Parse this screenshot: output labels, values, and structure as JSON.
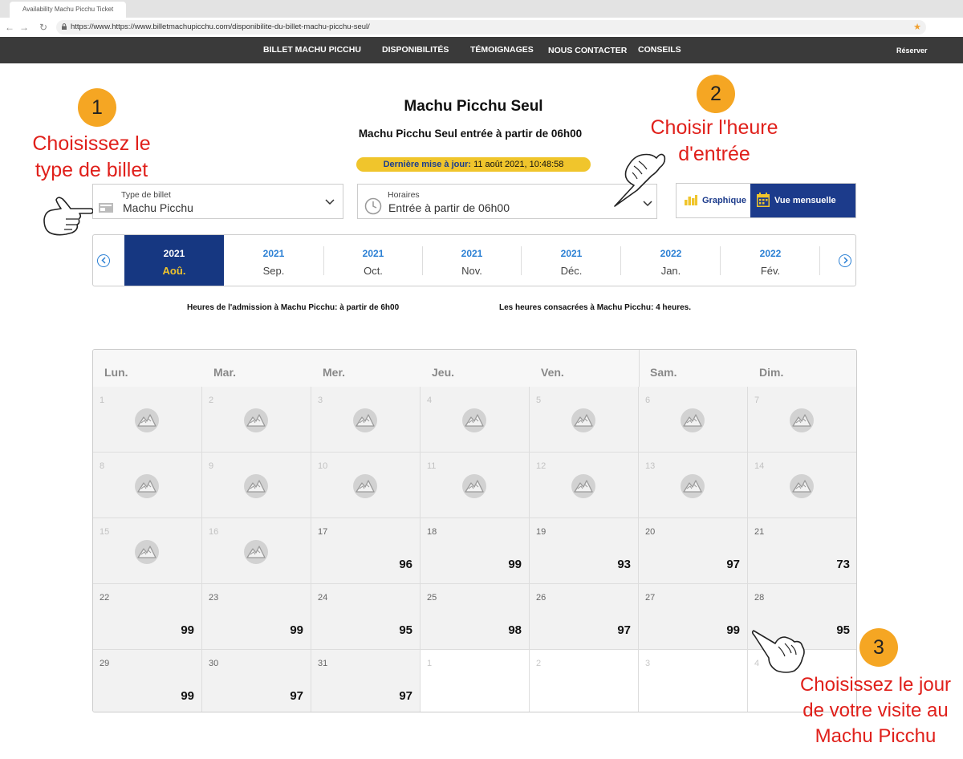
{
  "browser": {
    "tab_title": "Availability Machu Picchu Ticket",
    "url": "https://www.https://www.billetmachupicchu.com/disponibilite-du-billet-machu-picchu-seul/"
  },
  "nav": {
    "items": [
      "BILLET MACHU PICCHU",
      "DISPONIBILITÉS",
      "TÉMOIGNAGES",
      "NOUS CONTACTER",
      "CONSEILS"
    ],
    "reserve": "Réserver"
  },
  "page": {
    "title": "Machu Picchu Seul",
    "subtitle": "Machu Picchu Seul entrée à partir de 06h00",
    "update_label": "Dernière mise à jour:",
    "update_value": "11 août 2021, 10:48:58"
  },
  "annotations": {
    "step1_number": "1",
    "step1_line1": "Choisissez le",
    "step1_line2": "type de billet",
    "step2_number": "2",
    "step2_line1": "Choisir l'heure",
    "step2_line2": "d'entrée",
    "step3_number": "3",
    "step3_line1": "Choisissez le jour",
    "step3_line2": "de votre visite au",
    "step3_line3": "Machu Picchu"
  },
  "ticket_select": {
    "label": "Type de billet",
    "value": "Machu Picchu"
  },
  "hours_select": {
    "label": "Horaires",
    "value": "Entrée à partir de 06h00"
  },
  "view_toggle": {
    "graph": "Graphique",
    "month": "Vue mensuelle"
  },
  "months": [
    {
      "year": "2021",
      "month": "Aoû.",
      "selected": true
    },
    {
      "year": "2021",
      "month": "Sep.",
      "selected": false
    },
    {
      "year": "2021",
      "month": "Oct.",
      "selected": false
    },
    {
      "year": "2021",
      "month": "Nov.",
      "selected": false
    },
    {
      "year": "2021",
      "month": "Déc.",
      "selected": false
    },
    {
      "year": "2022",
      "month": "Jan.",
      "selected": false
    },
    {
      "year": "2022",
      "month": "Fév.",
      "selected": false
    }
  ],
  "info": {
    "admission": "Heures de l'admission à Machu Picchu: à partir de 6h00",
    "duration": "Les heures consacrées à Machu Picchu: 4 heures."
  },
  "calendar": {
    "days": [
      "Lun.",
      "Mar.",
      "Mer.",
      "Jeu.",
      "Ven.",
      "Sam.",
      "Dim."
    ],
    "cells": [
      {
        "d": "1",
        "s": "dis"
      },
      {
        "d": "2",
        "s": "dis"
      },
      {
        "d": "3",
        "s": "dis"
      },
      {
        "d": "4",
        "s": "dis"
      },
      {
        "d": "5",
        "s": "dis"
      },
      {
        "d": "6",
        "s": "dis"
      },
      {
        "d": "7",
        "s": "dis"
      },
      {
        "d": "8",
        "s": "dis"
      },
      {
        "d": "9",
        "s": "dis"
      },
      {
        "d": "10",
        "s": "dis"
      },
      {
        "d": "11",
        "s": "dis"
      },
      {
        "d": "12",
        "s": "dis"
      },
      {
        "d": "13",
        "s": "dis"
      },
      {
        "d": "14",
        "s": "dis"
      },
      {
        "d": "15",
        "s": "dis"
      },
      {
        "d": "16",
        "s": "dis"
      },
      {
        "d": "17",
        "s": "avail",
        "n": "96"
      },
      {
        "d": "18",
        "s": "avail",
        "n": "99"
      },
      {
        "d": "19",
        "s": "avail",
        "n": "93"
      },
      {
        "d": "20",
        "s": "avail",
        "n": "97"
      },
      {
        "d": "21",
        "s": "avail",
        "n": "73"
      },
      {
        "d": "22",
        "s": "avail",
        "n": "99"
      },
      {
        "d": "23",
        "s": "avail",
        "n": "99"
      },
      {
        "d": "24",
        "s": "avail",
        "n": "95"
      },
      {
        "d": "25",
        "s": "avail",
        "n": "98"
      },
      {
        "d": "26",
        "s": "avail",
        "n": "97"
      },
      {
        "d": "27",
        "s": "avail",
        "n": "99"
      },
      {
        "d": "28",
        "s": "avail",
        "n": "95"
      },
      {
        "d": "29",
        "s": "avail",
        "n": "99"
      },
      {
        "d": "30",
        "s": "avail",
        "n": "97"
      },
      {
        "d": "31",
        "s": "avail",
        "n": "97"
      },
      {
        "d": "1",
        "s": "empty"
      },
      {
        "d": "2",
        "s": "empty"
      },
      {
        "d": "3",
        "s": "empty"
      },
      {
        "d": "4",
        "s": "empty"
      }
    ]
  },
  "colors": {
    "nav_bg": "#3a3a3a",
    "selected_month_bg": "#163781",
    "accent_yellow": "#f0c52c",
    "annotation_red": "#e0201b",
    "badge_orange": "#f5a623",
    "link_blue": "#2a7fd4"
  }
}
